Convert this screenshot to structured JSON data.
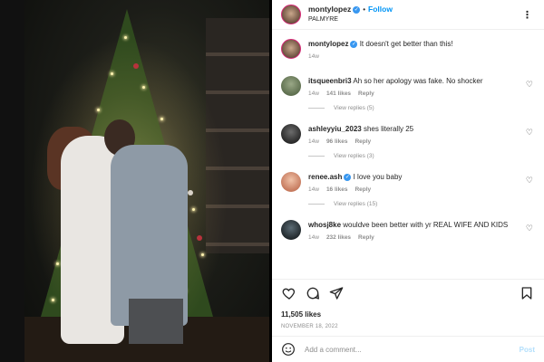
{
  "post": {
    "author": {
      "username": "montylopez",
      "verified": true
    },
    "follow_label": "Follow",
    "location": "PALMYRE",
    "caption": {
      "username": "montylopez",
      "text": "It doesn't get better than this!",
      "time": "14w"
    }
  },
  "comments": [
    {
      "username": "itsqueenbri3",
      "verified": false,
      "text": "Ah so her apology was fake. No shocker",
      "time": "14w",
      "likes": "141 likes",
      "reply_label": "Reply",
      "view_replies": "View replies (5)"
    },
    {
      "username": "ashleyyiu_2023",
      "verified": false,
      "text": "shes literally 25",
      "time": "14w",
      "likes": "96 likes",
      "reply_label": "Reply",
      "view_replies": "View replies (3)"
    },
    {
      "username": "renee.ash",
      "verified": true,
      "text": "I love you baby",
      "time": "14w",
      "likes": "16 likes",
      "reply_label": "Reply",
      "view_replies": "View replies (15)"
    },
    {
      "username": "whosj8ke",
      "verified": false,
      "text": "wouldve been better with yr REAL WIFE AND KIDS",
      "time": "14w",
      "likes": "232 likes",
      "reply_label": "Reply"
    }
  ],
  "engagement": {
    "likes": "11,505 likes",
    "date": "NOVEMBER 18, 2022"
  },
  "composer": {
    "placeholder": "Add a comment...",
    "post_label": "Post"
  },
  "icons": {
    "more": "more-options-icon",
    "like": "heart-icon",
    "comment": "comment-icon",
    "share": "share-icon",
    "save": "bookmark-icon",
    "emoji": "emoji-icon"
  },
  "colors": {
    "link": "#0095f6",
    "verified": "#3897f0",
    "muted": "#8e8e8e",
    "post_disabled": "#b2dffc"
  }
}
